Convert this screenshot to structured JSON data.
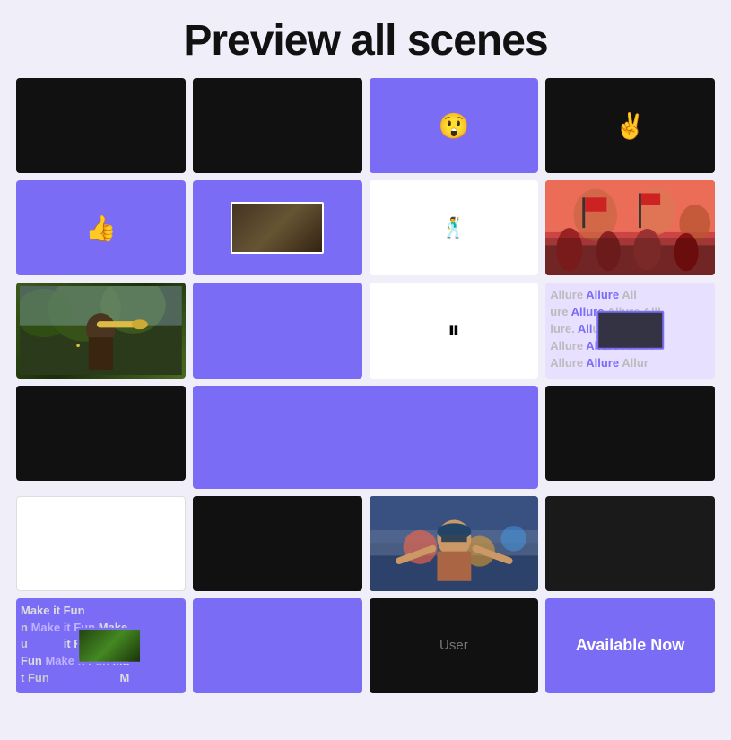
{
  "header": {
    "title": "Preview all scenes"
  },
  "grid": {
    "rows": [
      [
        {
          "type": "black",
          "id": "r1c1"
        },
        {
          "type": "black",
          "id": "r1c2"
        },
        {
          "type": "purple-emoji",
          "emoji": "😲",
          "id": "r1c3"
        },
        {
          "type": "black-emoji",
          "emoji": "✌️",
          "id": "r1c4"
        }
      ],
      [
        {
          "type": "purple-emoji",
          "emoji": "👍",
          "id": "r2c1"
        },
        {
          "type": "purple-thumb",
          "id": "r2c2"
        },
        {
          "type": "white-dancer",
          "id": "r2c3"
        },
        {
          "type": "concert",
          "id": "r2c4"
        }
      ],
      [
        {
          "type": "trumpet",
          "id": "r3c1"
        },
        {
          "type": "purple",
          "id": "r3c2"
        },
        {
          "type": "white-emoji",
          "emoji": "⏸",
          "id": "r3c3"
        },
        {
          "type": "allure",
          "id": "r3c4"
        }
      ],
      [
        {
          "type": "black",
          "id": "r4c1"
        },
        {
          "type": "purple-span2",
          "id": "r4c2",
          "span": 2
        },
        {
          "type": "black",
          "id": "r4c4"
        }
      ],
      [
        {
          "type": "white",
          "id": "r5c1"
        },
        {
          "type": "black",
          "id": "r5c2"
        },
        {
          "type": "girl",
          "id": "r5c3"
        },
        {
          "type": "dark",
          "id": "r5c4"
        }
      ],
      [
        {
          "type": "makefun",
          "id": "r6c1"
        },
        {
          "type": "purple",
          "id": "r6c2"
        },
        {
          "type": "user",
          "id": "r6c3"
        },
        {
          "type": "available-now",
          "id": "r6c4"
        }
      ]
    ],
    "available_now_label": "Available Now",
    "user_label": "User"
  }
}
